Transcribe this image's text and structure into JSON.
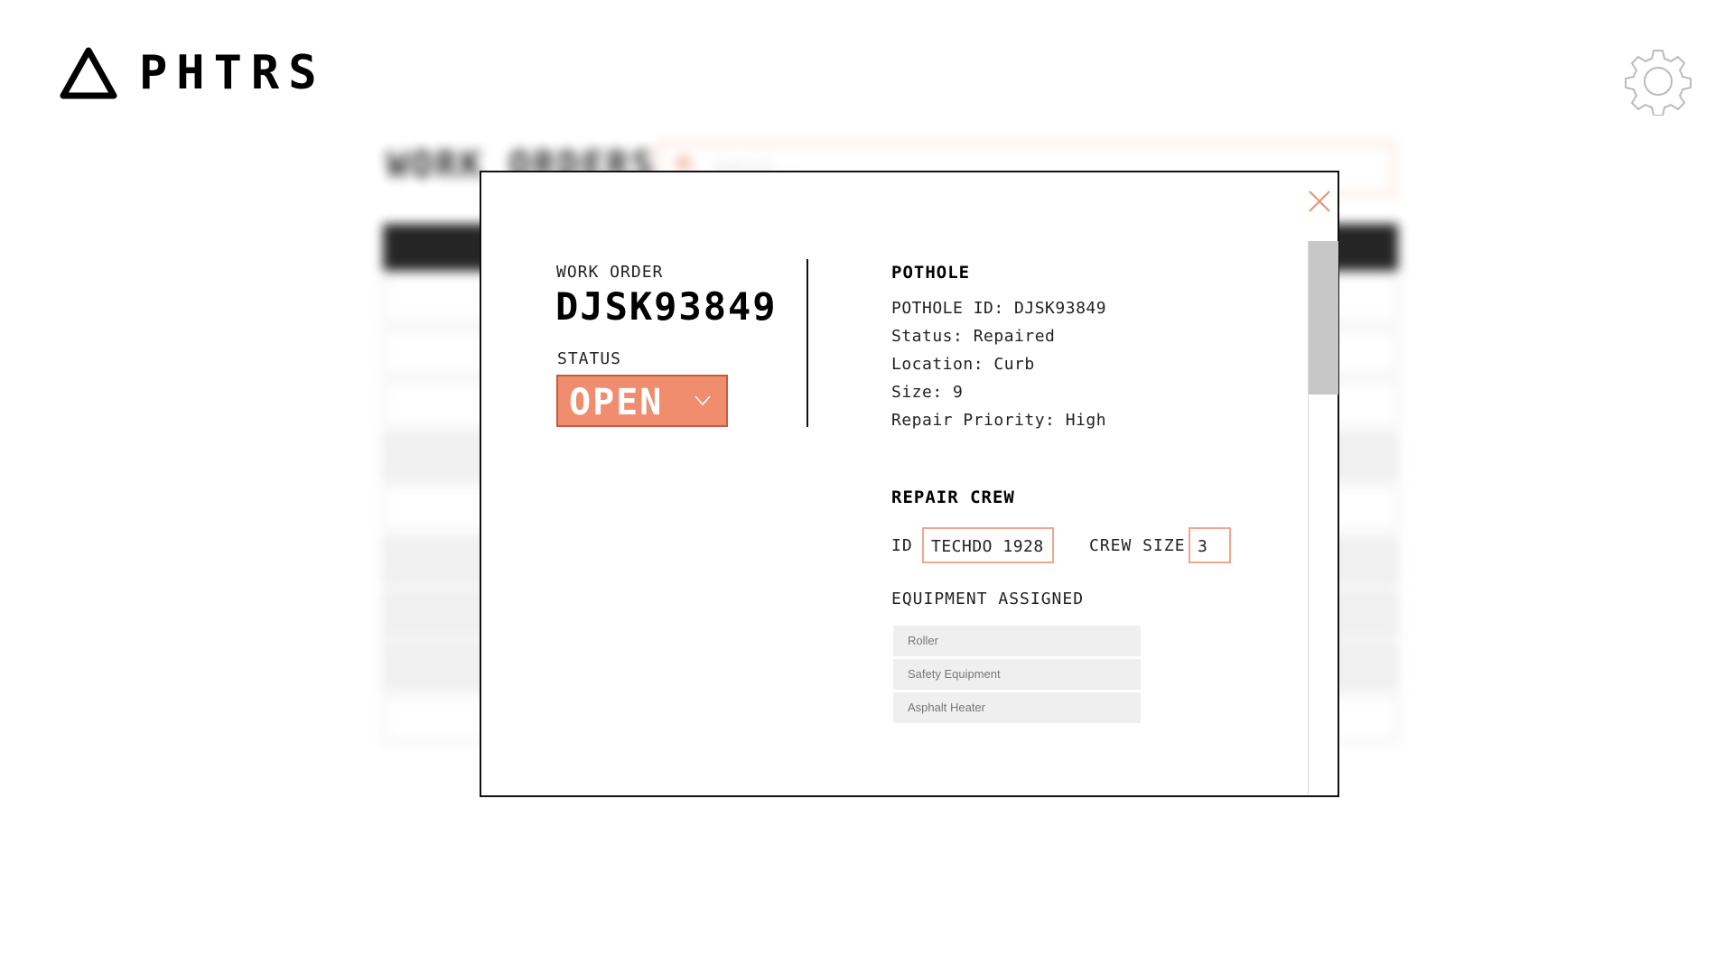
{
  "app": {
    "brand": "PHTRS",
    "logo_icon": "triangle-logo-icon",
    "settings_icon": "gear-icon"
  },
  "background": {
    "title": "WORK ORDERS",
    "search_placeholder": "Search..."
  },
  "modal": {
    "work_order_label": "WORK ORDER",
    "work_order_id": "DJSK93849",
    "status_label": "STATUS",
    "status_value": "OPEN",
    "close_icon": "close-icon",
    "pothole": {
      "title": "POTHOLE",
      "id_line": "POTHOLE ID: DJSK93849",
      "status_line": "Status: Repaired",
      "location_line": "Location: Curb",
      "size_line": "Size: 9",
      "priority_line": "Repair Priority: High"
    },
    "crew": {
      "title": "REPAIR CREW",
      "id_label": "ID",
      "id_value": "TECHDO 1928",
      "size_label": "CREW SIZE",
      "size_value": "3"
    },
    "equipment": {
      "title": "EQUIPMENT ASSIGNED",
      "items": [
        "Roller",
        "Safety Equipment",
        "Asphalt Heater"
      ]
    }
  },
  "colors": {
    "accent": "#f08d6e",
    "accent_border": "#f2a68e",
    "text": "#111111"
  }
}
